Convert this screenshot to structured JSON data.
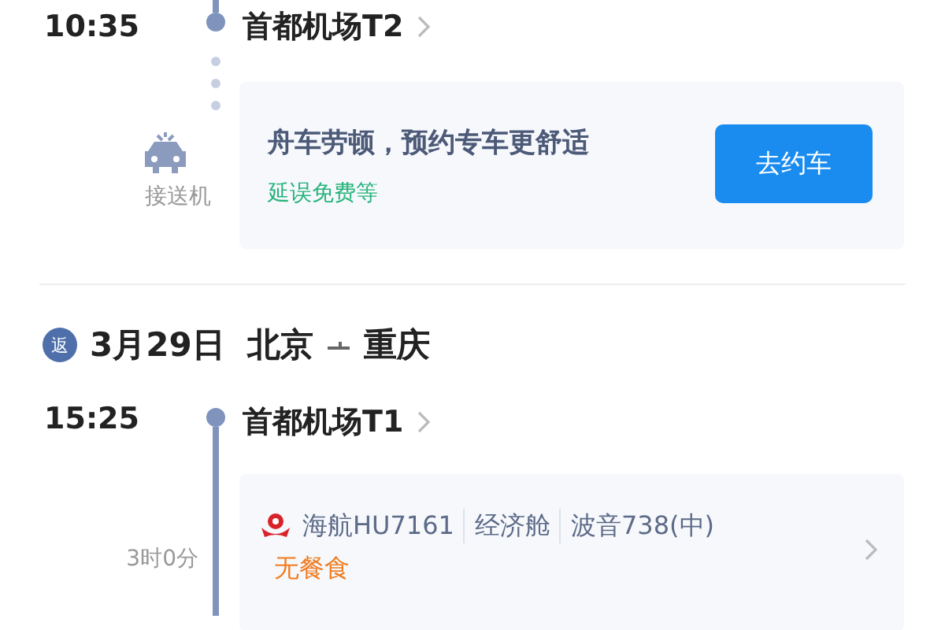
{
  "outbound": {
    "arrival_time": "10:35",
    "arrival_airport": "首都机场T2",
    "transfer_label": "接送机",
    "promo": {
      "title": "舟车劳顿，预约专车更舒适",
      "subtitle": "延误免费等",
      "button": "去约车"
    }
  },
  "return": {
    "badge": "返",
    "date": "3月29日",
    "from": "北京",
    "to": "重庆",
    "departure_time": "15:25",
    "departure_airport": "首都机场T1",
    "duration": "3时0分",
    "flight": {
      "airline_flight": "海航HU7161",
      "cabin": "经济舱",
      "aircraft": "波音738(中)",
      "meal": "无餐食"
    }
  }
}
